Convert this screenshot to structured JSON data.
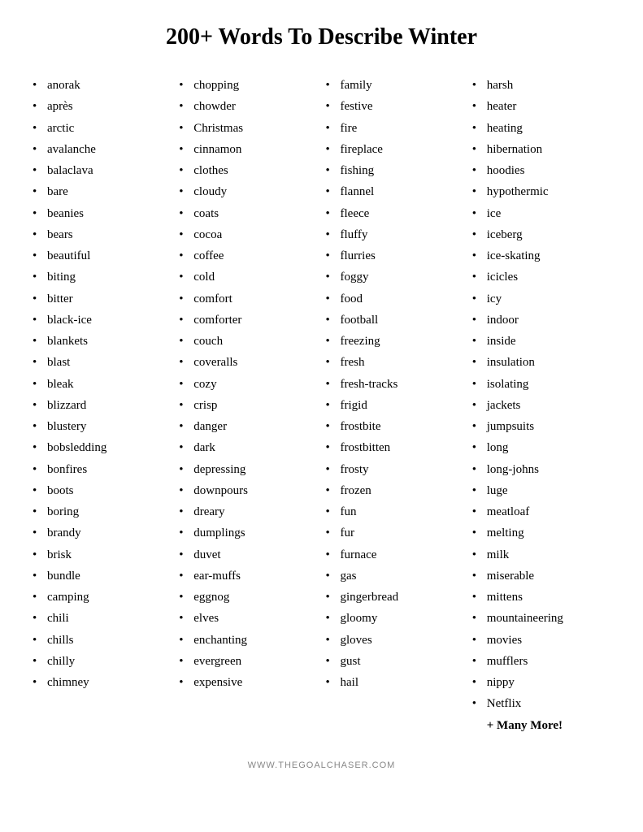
{
  "title": "200+ Words To Describe Winter",
  "columns": [
    {
      "id": "col1",
      "words": [
        "anorak",
        "après",
        "arctic",
        "avalanche",
        "balaclava",
        "bare",
        "beanies",
        "bears",
        "beautiful",
        "biting",
        "bitter",
        "black-ice",
        "blankets",
        "blast",
        "bleak",
        "blizzard",
        "blustery",
        "bobsledding",
        "bonfires",
        "boots",
        "boring",
        "brandy",
        "brisk",
        "bundle",
        "camping",
        "chili",
        "chills",
        "chilly",
        "chimney"
      ]
    },
    {
      "id": "col2",
      "words": [
        "chopping",
        "chowder",
        "Christmas",
        "cinnamon",
        "clothes",
        "cloudy",
        "coats",
        "cocoa",
        "coffee",
        "cold",
        "comfort",
        "comforter",
        "couch",
        "coveralls",
        "cozy",
        "crisp",
        "danger",
        "dark",
        "depressing",
        "downpours",
        "dreary",
        "dumplings",
        "duvet",
        "ear-muffs",
        "eggnog",
        "elves",
        "enchanting",
        "evergreen",
        "expensive"
      ]
    },
    {
      "id": "col3",
      "words": [
        "family",
        "festive",
        "fire",
        "fireplace",
        "fishing",
        "flannel",
        "fleece",
        "fluffy",
        "flurries",
        "foggy",
        "food",
        "football",
        "freezing",
        "fresh",
        "fresh-tracks",
        "frigid",
        "frostbite",
        "frostbitten",
        "frosty",
        "frozen",
        "fun",
        "fur",
        "furnace",
        "gas",
        "gingerbread",
        "gloomy",
        "gloves",
        "gust",
        "hail"
      ]
    },
    {
      "id": "col4",
      "words": [
        "harsh",
        "heater",
        "heating",
        "hibernation",
        "hoodies",
        "hypothermic",
        "ice",
        "iceberg",
        "ice-skating",
        "icicles",
        "icy",
        "indoor",
        "inside",
        "insulation",
        "isolating",
        "jackets",
        "jumpsuits",
        "long",
        "long-johns",
        "luge",
        "meatloaf",
        "melting",
        "milk",
        "miserable",
        "mittens",
        "mountaineering",
        "movies",
        "mufflers",
        "nippy",
        "Netflix"
      ],
      "extra": "+ Many More!"
    }
  ],
  "footer": "WWW.THEGOALCHASER.COM"
}
